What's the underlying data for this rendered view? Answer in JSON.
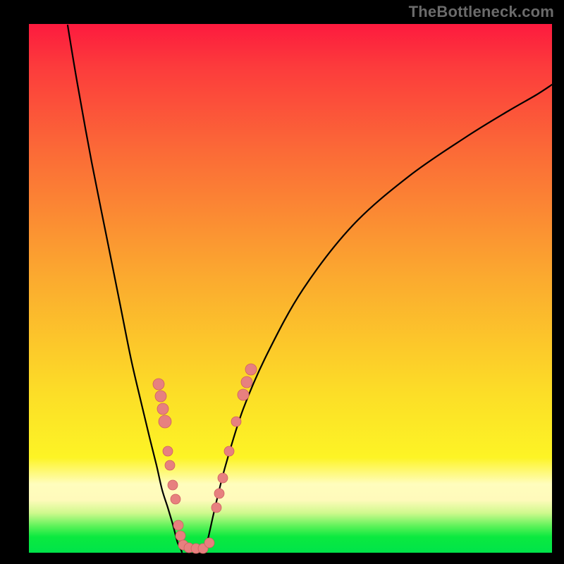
{
  "watermark": "TheBottleneck.com",
  "colors": {
    "curve": "#000000",
    "marker_fill": "#e7807f",
    "marker_stroke": "#cf6160",
    "frame": "#000000"
  },
  "chart_data": {
    "type": "line",
    "title": "",
    "xlabel": "",
    "ylabel": "",
    "xlim": [
      41,
      783
    ],
    "ylim": [
      34,
      784
    ],
    "series": [
      {
        "name": "left-curve",
        "x": [
          96,
          110,
          130,
          150,
          170,
          186,
          200,
          212,
          222,
          230,
          238,
          244,
          248,
          252,
          256,
          258
        ],
        "y": [
          36,
          120,
          230,
          330,
          430,
          510,
          570,
          620,
          660,
          695,
          720,
          740,
          755,
          770,
          778,
          783
        ]
      },
      {
        "name": "right-curve",
        "x": [
          290,
          296,
          305,
          320,
          345,
          380,
          430,
          500,
          580,
          660,
          720,
          760,
          783
        ],
        "y": [
          783,
          760,
          720,
          660,
          580,
          500,
          410,
          320,
          250,
          195,
          158,
          135,
          120
        ]
      }
    ],
    "markers": [
      {
        "x": 225,
        "y": 545,
        "r": 8
      },
      {
        "x": 228,
        "y": 562,
        "r": 8
      },
      {
        "x": 231,
        "y": 580,
        "r": 8
      },
      {
        "x": 234,
        "y": 598,
        "r": 9
      },
      {
        "x": 238,
        "y": 640,
        "r": 7
      },
      {
        "x": 241,
        "y": 660,
        "r": 7
      },
      {
        "x": 245,
        "y": 688,
        "r": 7
      },
      {
        "x": 249,
        "y": 708,
        "r": 7
      },
      {
        "x": 253,
        "y": 745,
        "r": 7
      },
      {
        "x": 256,
        "y": 760,
        "r": 7
      },
      {
        "x": 260,
        "y": 773,
        "r": 7
      },
      {
        "x": 268,
        "y": 777,
        "r": 7
      },
      {
        "x": 278,
        "y": 778,
        "r": 7
      },
      {
        "x": 288,
        "y": 778,
        "r": 7
      },
      {
        "x": 297,
        "y": 770,
        "r": 7
      },
      {
        "x": 307,
        "y": 720,
        "r": 7
      },
      {
        "x": 311,
        "y": 700,
        "r": 7
      },
      {
        "x": 316,
        "y": 678,
        "r": 7
      },
      {
        "x": 325,
        "y": 640,
        "r": 7
      },
      {
        "x": 335,
        "y": 598,
        "r": 7
      },
      {
        "x": 345,
        "y": 560,
        "r": 8
      },
      {
        "x": 350,
        "y": 542,
        "r": 8
      },
      {
        "x": 356,
        "y": 524,
        "r": 8
      }
    ]
  }
}
